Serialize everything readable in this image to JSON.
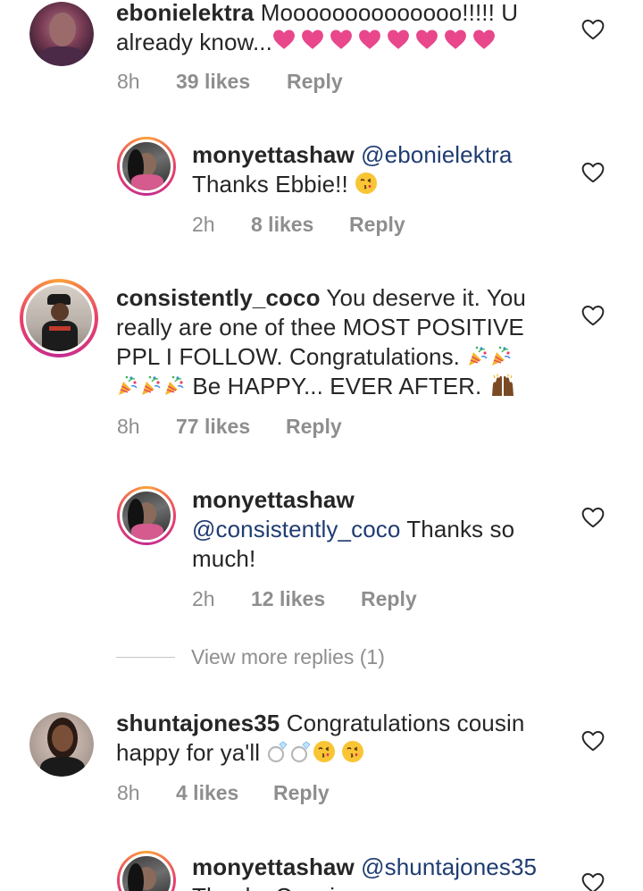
{
  "comments": [
    {
      "username": "ebonielektra",
      "line1": "Moooooooooooooo!!!!! U",
      "line2": "already know...",
      "time": "8h",
      "likes": "39 likes",
      "reply": "Reply",
      "emoji": [
        "pink-heart",
        "pink-heart",
        "pink-heart",
        "pink-heart",
        "pink-heart",
        "pink-heart",
        "pink-heart",
        "pink-heart"
      ]
    },
    {
      "username": "monyettashaw",
      "mention": "@ebonielektra",
      "line2": "Thanks Ebbie!!",
      "time": "2h",
      "likes": "8 likes",
      "reply": "Reply",
      "emoji": [
        "kissing-face"
      ]
    },
    {
      "username": "consistently_coco",
      "line1": "You deserve it. You",
      "line2": "really are one of thee MOST POSITIVE",
      "line3": "PPL I FOLLOW. Congratulations.",
      "line4": "Be HAPPY... EVER AFTER.",
      "time": "8h",
      "likes": "77 likes",
      "reply": "Reply",
      "emoji": [
        "party-popper",
        "party-popper",
        "party-popper",
        "party-popper",
        "party-popper",
        "raising-hands"
      ]
    },
    {
      "username": "monyettashaw",
      "mention": "@consistently_coco",
      "line1": "Thanks so",
      "line2": "much!",
      "time": "2h",
      "likes": "12 likes",
      "reply": "Reply"
    },
    {
      "username": "shuntajones35",
      "line1": "Congratulations cousin",
      "line2": "happy for ya'll",
      "time": "8h",
      "likes": "4 likes",
      "reply": "Reply",
      "emoji": [
        "ring",
        "ring",
        "kissing-face",
        "kissing-face"
      ]
    },
    {
      "username": "monyettashaw",
      "mention": "@shuntajones35",
      "line2": "Thanks Cousin"
    }
  ],
  "view_more": "View more replies (1)",
  "icons": {
    "like": "heart-outline-icon"
  },
  "colors": {
    "mention": "#1f3c72",
    "meta": "#8e8e8e",
    "pink_heart": "#e8478b"
  }
}
